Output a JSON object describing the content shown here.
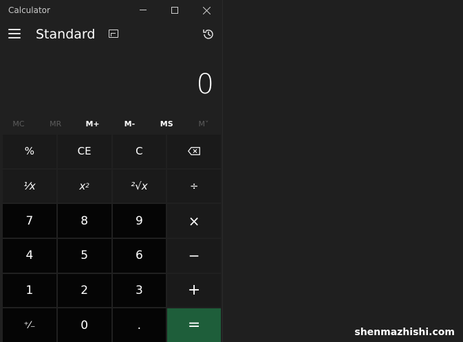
{
  "window": {
    "title": "Calculator"
  },
  "header": {
    "mode": "Standard"
  },
  "display": {
    "value": "0"
  },
  "memory": [
    "MC",
    "MR",
    "M+",
    "M-",
    "MS",
    "M˅"
  ],
  "keys": {
    "percent": "%",
    "ce": "CE",
    "c": "C",
    "reciprocal": "¹⁄x",
    "square_base": "x",
    "square_exp": "2",
    "sqrt": "²√x",
    "divide": "÷",
    "seven": "7",
    "eight": "8",
    "nine": "9",
    "multiply": "×",
    "four": "4",
    "five": "5",
    "six": "6",
    "minus": "−",
    "one": "1",
    "two": "2",
    "three": "3",
    "plus": "+",
    "negate": "⁺⁄₋",
    "zero": "0",
    "decimal": ".",
    "equals": "="
  },
  "watermark": "shenmazhishi.com",
  "colors": {
    "equals": "#1e5e3a",
    "background": "#202020"
  }
}
